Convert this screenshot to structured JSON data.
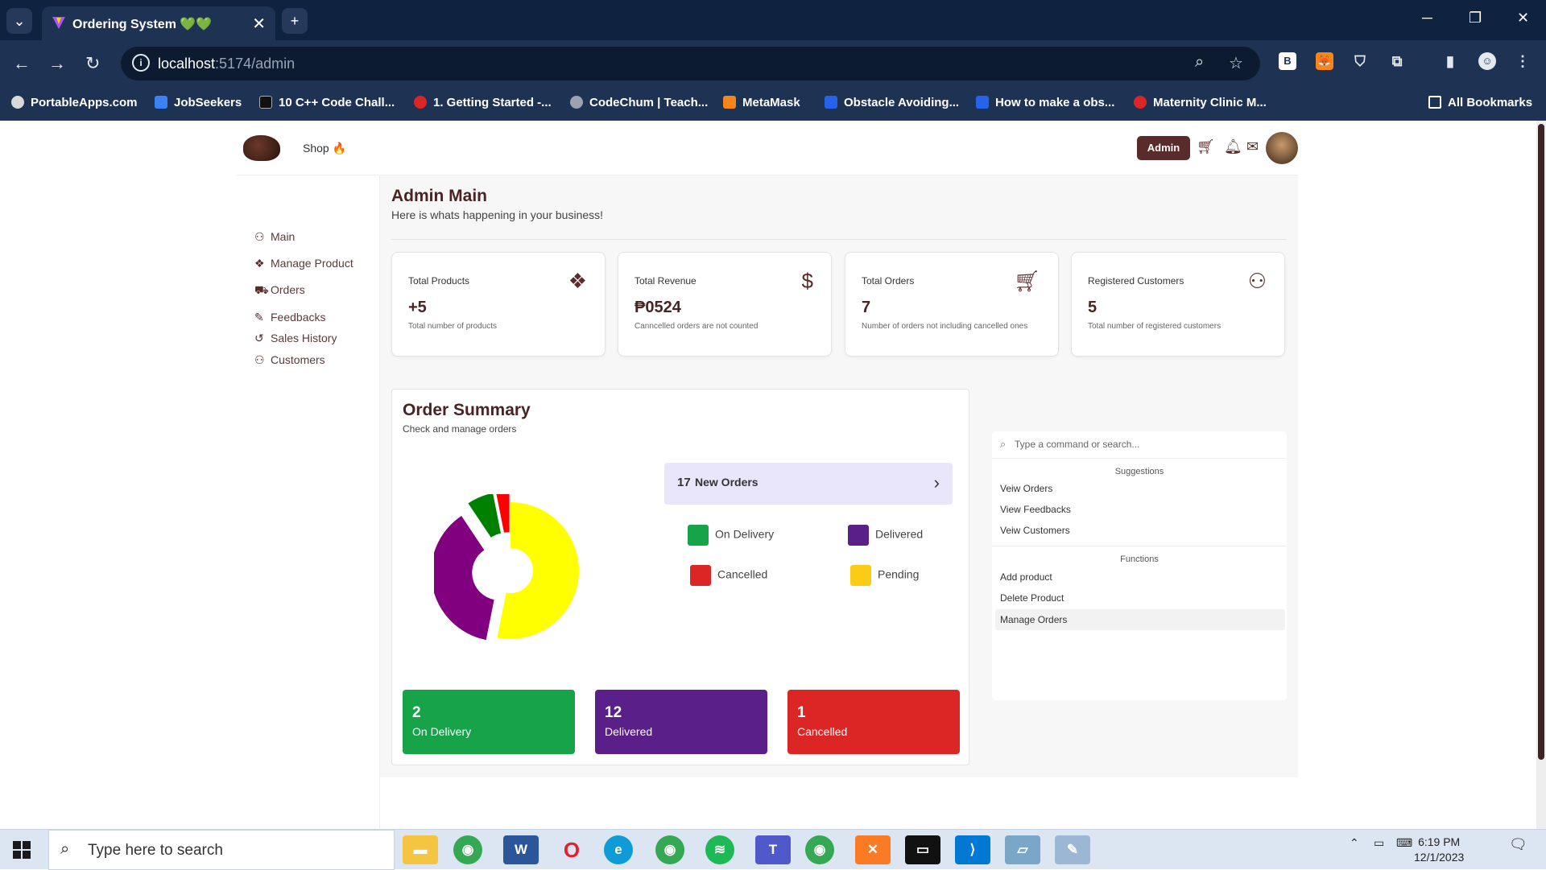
{
  "browser": {
    "tab_title": "Ordering System 💚💚",
    "url_host": "localhost",
    "url_rest": ":5174/admin",
    "bookmarks": [
      "PortableApps.com",
      "JobSeekers",
      "10 C++ Code Chall...",
      "1. Getting Started -...",
      "CodeChum | Teach...",
      "MetaMask",
      "Obstacle Avoiding...",
      "How to make a obs...",
      "Maternity Clinic M..."
    ],
    "all_bookmarks": "All Bookmarks",
    "extension_b": "B"
  },
  "topnav": {
    "shop": "Shop 🔥",
    "admin": "Admin"
  },
  "sidebar": {
    "items": [
      {
        "label": "Main",
        "icon": "user-icon"
      },
      {
        "label": "Manage Product",
        "icon": "dropbox-icon"
      },
      {
        "label": "Orders",
        "icon": "cart-icon"
      },
      {
        "label": "Feedbacks",
        "icon": "feedback-icon"
      },
      {
        "label": "Sales History",
        "icon": "history-icon"
      },
      {
        "label": "Customers",
        "icon": "users-icon"
      }
    ]
  },
  "header": {
    "title": "Admin Main",
    "subtitle": "Here is whats happening in your business!"
  },
  "cards": [
    {
      "title": "Total Products",
      "value": "+5",
      "desc": "Total number of products",
      "icon": "dropbox-icon"
    },
    {
      "title": "Total Revenue",
      "value": "₱0524",
      "desc": "Canncelled orders are not counted",
      "icon": "dollar-icon"
    },
    {
      "title": "Total Orders",
      "value": "7",
      "desc": "Number of orders not including cancelled ones",
      "icon": "cart-plus-icon"
    },
    {
      "title": "Registered Customers",
      "value": "5",
      "desc": "Total number of registered customers",
      "icon": "users-icon"
    }
  ],
  "summary": {
    "title": "Order Summary",
    "subtitle": "Check and manage orders",
    "new_orders_count": "17",
    "new_orders_label": "New Orders",
    "legend": [
      {
        "label": "On Delivery",
        "color": "#16a34a"
      },
      {
        "label": "Delivered",
        "color": "#5b1f8a"
      },
      {
        "label": "Cancelled",
        "color": "#dc2626"
      },
      {
        "label": "Pending",
        "color": "#facc15"
      }
    ],
    "stats": [
      {
        "value": "2",
        "label": "On Delivery",
        "color": "#16a34a"
      },
      {
        "value": "12",
        "label": "Delivered",
        "color": "#5b1f8a"
      },
      {
        "value": "1",
        "label": "Cancelled",
        "color": "#dc2626"
      }
    ]
  },
  "chart_data": {
    "type": "pie",
    "categories": [
      "Pending",
      "Delivered",
      "On Delivery",
      "Cancelled"
    ],
    "values": [
      17,
      12,
      2,
      1
    ],
    "colors": [
      "#ffff00",
      "#800080",
      "#008000",
      "#ff0000"
    ]
  },
  "command": {
    "placeholder": "Type a command or search...",
    "suggestions_heading": "Suggestions",
    "suggestions": [
      "Veiw Orders",
      "View Feedbacks",
      "Veiw Customers"
    ],
    "functions_heading": "Functions",
    "functions": [
      "Add product",
      "Delete Product",
      "Manage Orders"
    ]
  },
  "taskbar": {
    "search_placeholder": "Type here to search",
    "time": "6:19 PM",
    "date": "12/1/2023"
  }
}
